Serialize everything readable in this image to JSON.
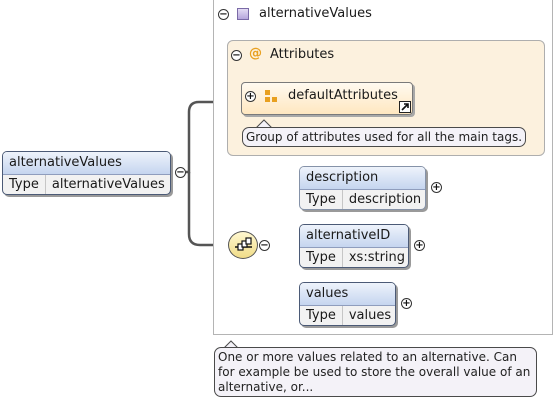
{
  "root": {
    "name": "alternativeValues",
    "type_label": "Type",
    "type_value": "alternativeValues"
  },
  "complex_type": {
    "title": "alternativeValues",
    "icon": "complex-type-icon"
  },
  "attributes": {
    "title": "Attributes",
    "icon": "at-sign-icon",
    "group": {
      "name": "defaultAttributes",
      "icon": "attribute-group-icon",
      "link_icon": "reference-arrow-icon"
    },
    "annotation": "Group of attributes used for all the main tags."
  },
  "sequence": {
    "icon": "sequence-compositor-icon"
  },
  "elements": [
    {
      "name": "description",
      "type_label": "Type",
      "type_value": "description",
      "optional": true
    },
    {
      "name": "alternativeID",
      "type_label": "Type",
      "type_value": "xs:string",
      "optional": false
    },
    {
      "name": "values",
      "type_label": "Type",
      "type_value": "values",
      "optional": false
    }
  ],
  "annotation": "One or more values related to an alternative. Can for example be used to store the overall value of an alternative, or..."
}
